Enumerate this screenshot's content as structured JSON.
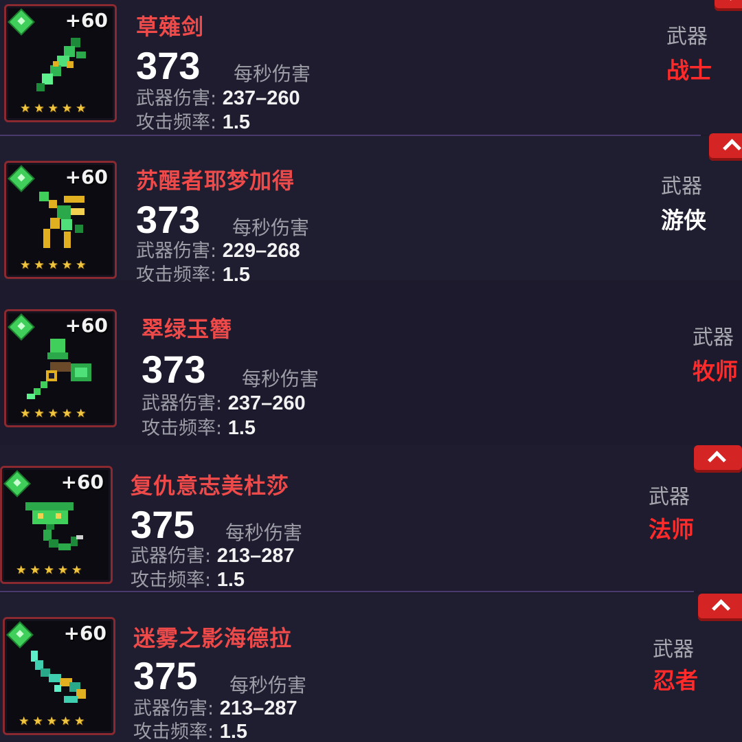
{
  "labels": {
    "dps_label": "每秒伤害",
    "damage_label": "武器伤害:",
    "rate_label": "攻击频率:",
    "category": "武器",
    "plus_level": "+60"
  },
  "colors": {
    "name_red": "#ef4a4a",
    "class_red": "#ff2a2a",
    "class_white": "#ffffff",
    "frame_red": "#8a2a30",
    "star_gold": "#f0c540",
    "gem_green": "#3fcf5a"
  },
  "items": [
    {
      "name": "草薙剑",
      "dps": "373",
      "damage": "237–260",
      "rate": "1.5",
      "class": "战士",
      "class_color": "#ff2a2a",
      "stars": 5,
      "icon": "emerald-sword-icon"
    },
    {
      "name": "苏醒者耶梦加得",
      "dps": "373",
      "damage": "229–268",
      "rate": "1.5",
      "class": "游侠",
      "class_color": "#ffffff",
      "stars": 5,
      "icon": "serpent-bow-icon"
    },
    {
      "name": "翠绿玉簪",
      "dps": "373",
      "damage": "237–260",
      "rate": "1.5",
      "class": "牧师",
      "class_color": "#ff2a2a",
      "stars": 5,
      "icon": "jade-hammer-staff-icon"
    },
    {
      "name": "复仇意志美杜莎",
      "dps": "375",
      "damage": "213–287",
      "rate": "1.5",
      "class": "法师",
      "class_color": "#ff2a2a",
      "stars": 5,
      "icon": "medusa-serpent-icon"
    },
    {
      "name": "迷雾之影海德拉",
      "dps": "375",
      "damage": "213–287",
      "rate": "1.5",
      "class": "忍者",
      "class_color": "#ff2a2a",
      "stars": 5,
      "icon": "hydra-blade-icon"
    }
  ]
}
